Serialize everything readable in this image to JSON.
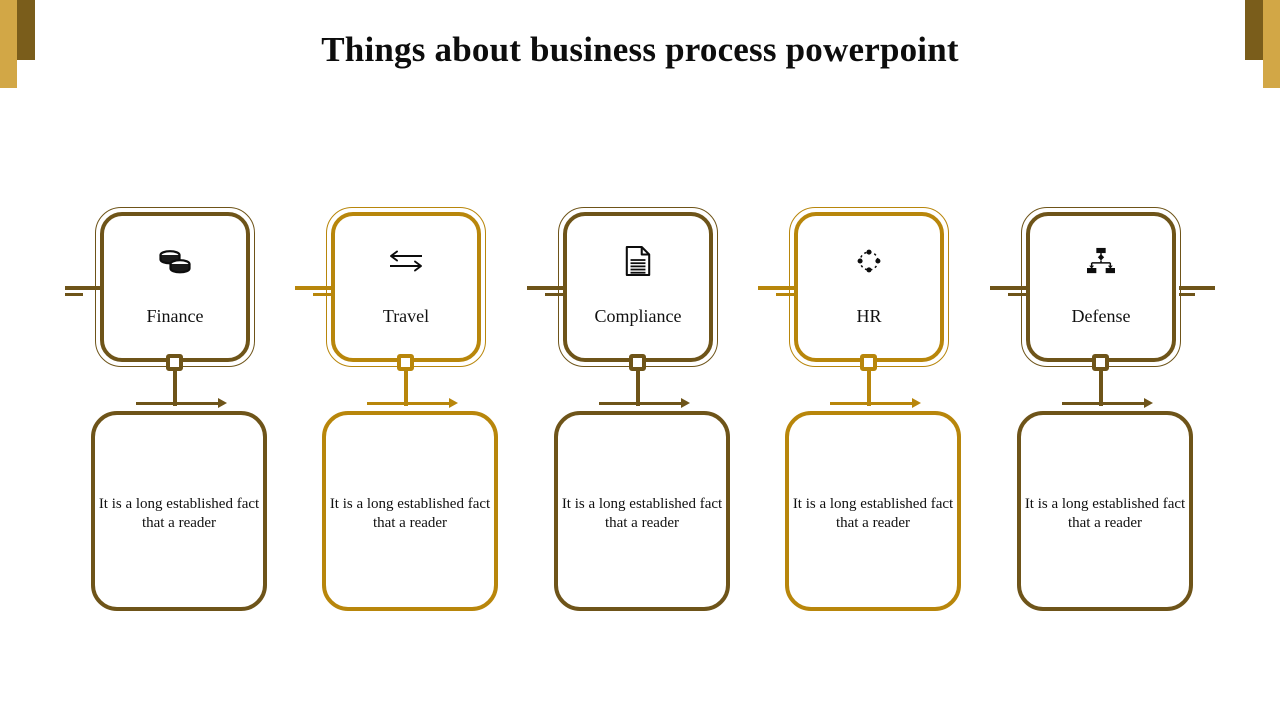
{
  "slide": {
    "title": "Things about business process powerpoint",
    "background_color": "#ffffff"
  },
  "decor": {
    "light_gold": "#D2A746",
    "dark_brown": "#7A5D1B",
    "corner_top_left_light": "corner-bar-light",
    "corner_top_left_dark": "corner-bar-dark",
    "corner_top_right_light": "corner-bar-light",
    "corner_top_right_dark": "corner-bar-dark"
  },
  "palette": {
    "brown": "#6E5419",
    "gold": "#B8860B",
    "text": "#111111"
  },
  "steps": [
    {
      "label": "Finance",
      "icon": "coins-icon",
      "color": "#6E5419",
      "description": "It is a long established fact that a reader"
    },
    {
      "label": "Travel",
      "icon": "exchange-arrows-icon",
      "color": "#B8860B",
      "description": "It is a long established fact that a reader"
    },
    {
      "label": "Compliance",
      "icon": "document-icon",
      "color": "#6E5419",
      "description": "It is a long established fact that a reader"
    },
    {
      "label": "HR",
      "icon": "network-dots-icon",
      "color": "#B8860B",
      "description": "It is a long established fact that a reader"
    },
    {
      "label": "Defense",
      "icon": "hierarchy-icon",
      "color": "#6E5419",
      "description": "It is a long established fact that a reader"
    }
  ]
}
